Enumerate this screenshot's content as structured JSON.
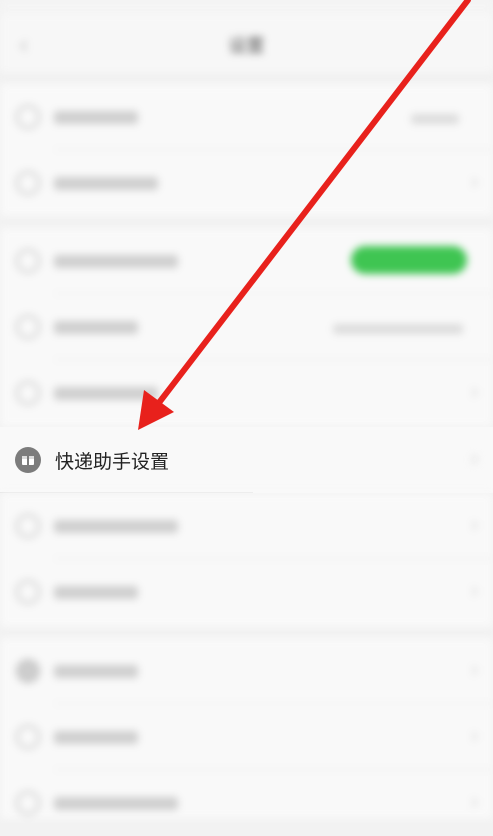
{
  "nav": {
    "title": "设置",
    "back_icon": "chevron-left-icon"
  },
  "highlight_row": {
    "label": "快递助手设置",
    "icon": "package-box-icon"
  },
  "arrow": {
    "color": "#e8211c"
  },
  "colors": {
    "toggle_on": "#3fc552",
    "background": "#f2f2f2"
  }
}
